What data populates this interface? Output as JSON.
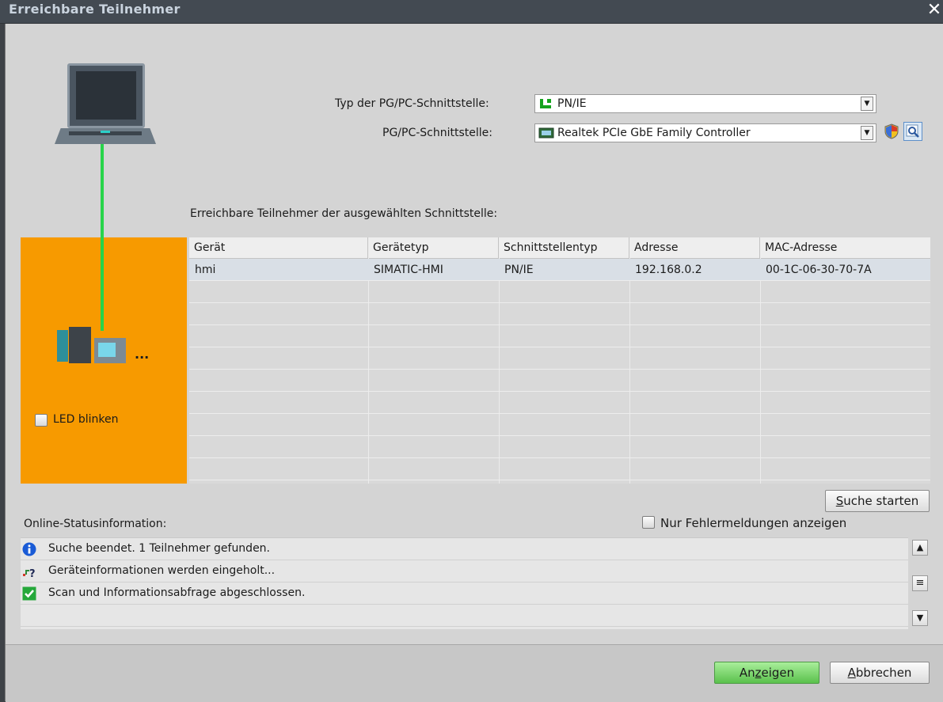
{
  "window": {
    "title": "Erreichbare Teilnehmer",
    "close_glyph": "✕"
  },
  "interface": {
    "type_label": "Typ der PG/PC-Schnittstelle:",
    "type_value": "PN/IE",
    "interface_label": "PG/PC-Schnittstelle:",
    "interface_value": "Realtek PCIe GbE Family Controller"
  },
  "devices_panel": {
    "more_indicator": "...",
    "led_label": "LED blinken"
  },
  "table": {
    "caption": "Erreichbare Teilnehmer der ausgewählten Schnittstelle:",
    "columns": [
      "Gerät",
      "Gerätetyp",
      "Schnittstellentyp",
      "Adresse",
      "MAC-Adresse"
    ],
    "rows": [
      [
        "hmi",
        "SIMATIC-HMI",
        "PN/IE",
        "192.168.0.2",
        "00-1C-06-30-70-7A"
      ]
    ],
    "selected_row": 0
  },
  "search_button": {
    "accesskey": "S",
    "rest": "uche starten"
  },
  "status": {
    "label": "Online-Statusinformation:",
    "errors_only_label": "Nur Fehlermeldungen anzeigen",
    "messages": [
      {
        "icon": "info-icon",
        "text": "Suche beendet. 1 Teilnehmer gefunden."
      },
      {
        "icon": "network-query-icon",
        "text": "Geräteinformationen werden eingeholt..."
      },
      {
        "icon": "check-icon",
        "text": "Scan und Informationsabfrage abgeschlossen."
      }
    ]
  },
  "footer": {
    "show_pre": "An",
    "show_key": "z",
    "show_post": "eigen",
    "cancel_key": "A",
    "cancel_rest": "bbrechen"
  },
  "colors": {
    "orange_panel": "#f79a00",
    "connection_line": "#27d44a",
    "show_button": "#6fd35e",
    "selected_row": "#d9dfe6"
  }
}
